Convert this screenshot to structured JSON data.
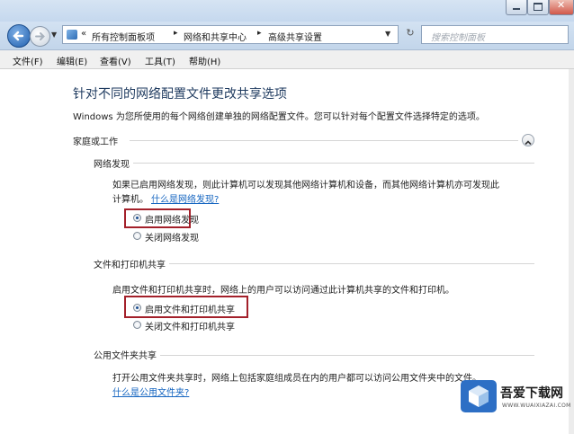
{
  "breadcrumb": {
    "chevron": "«",
    "items": [
      "所有控制面板项",
      "网络和共享中心",
      "高级共享设置"
    ]
  },
  "search": {
    "placeholder": "搜索控制面板"
  },
  "menu": [
    "文件(F)",
    "编辑(E)",
    "查看(V)",
    "工具(T)",
    "帮助(H)"
  ],
  "page": {
    "title": "针对不同的网络配置文件更改共享选项",
    "description": "Windows 为您所使用的每个网络创建单独的网络配置文件。您可以针对每个配置文件选择特定的选项。",
    "profile": "家庭或工作",
    "sections": [
      {
        "title": "网络发现",
        "text_line1": "如果已启用网络发现，则此计算机可以发现其他网络计算机和设备，而其他网络计算机亦可发现此",
        "text_line2": "计算机。",
        "link": "什么是网络发现?",
        "options": [
          {
            "label": "启用网络发现",
            "selected": true
          },
          {
            "label": "关闭网络发现",
            "selected": false
          }
        ]
      },
      {
        "title": "文件和打印机共享",
        "text_line1": "启用文件和打印机共享时，网络上的用户可以访问通过此计算机共享的文件和打印机。",
        "options": [
          {
            "label": "启用文件和打印机共享",
            "selected": true
          },
          {
            "label": "关闭文件和打印机共享",
            "selected": false
          }
        ]
      },
      {
        "title": "公用文件夹共享",
        "text_line1": "打开公用文件夹共享时，网络上包括家庭组成员在内的用户都可以访问公用文件夹中的文件。",
        "link": "什么是公用文件夹?"
      }
    ]
  },
  "watermark": {
    "title": "吾爱下载网",
    "subtitle": "WWW.WUAIXIAZAI.COM"
  },
  "colors": {
    "highlight_border": "#a3202a",
    "link": "#1565c0",
    "title": "#1e3a5f"
  },
  "icons": [
    "back-arrow-icon",
    "forward-arrow-icon",
    "refresh-icon",
    "collapse-chevron-icon",
    "window-minimize-icon",
    "window-maximize-icon",
    "window-close-icon"
  ]
}
